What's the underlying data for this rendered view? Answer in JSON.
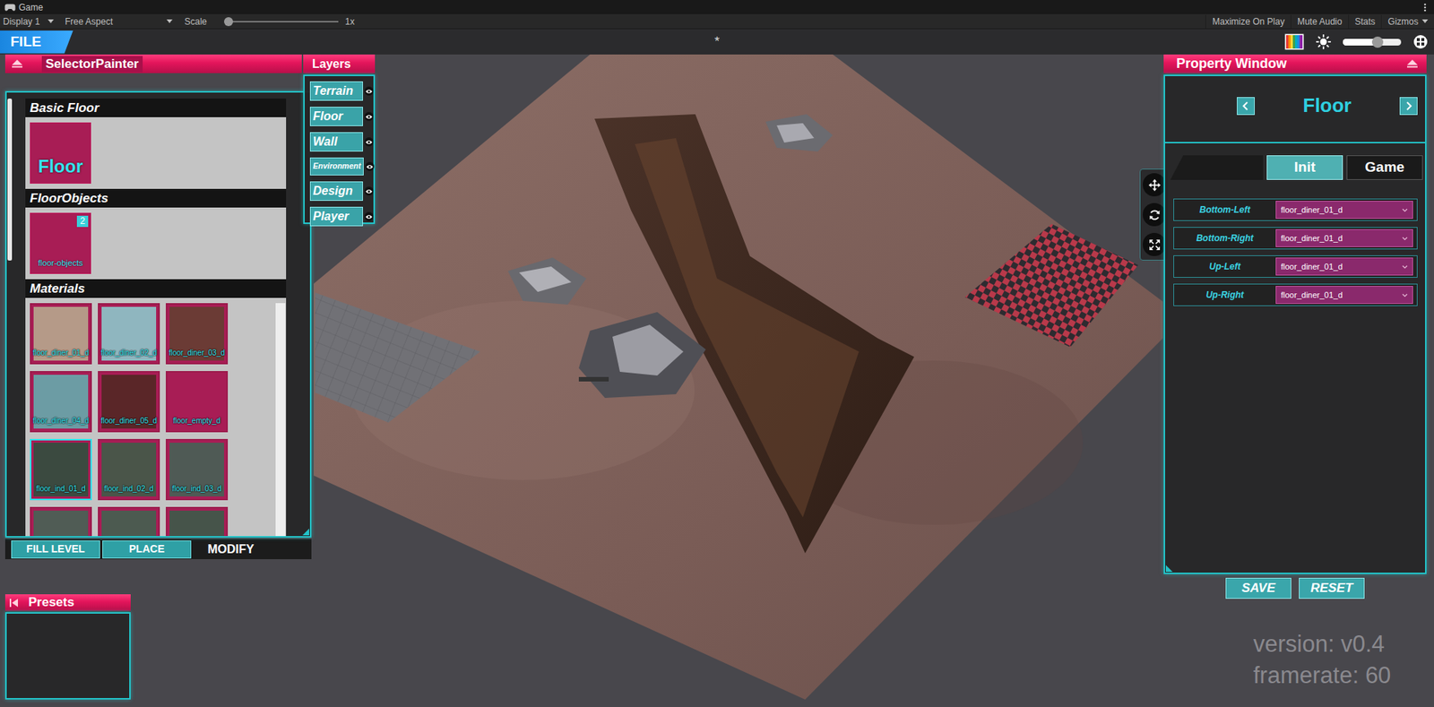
{
  "editor_tab": {
    "title": "Game"
  },
  "unity_toolbar": {
    "display": "Display 1",
    "aspect": "Free Aspect",
    "scale_label": "Scale",
    "scale_level": 0.02,
    "scale_value": "1x",
    "buttons": [
      {
        "label": "Maximize On Play",
        "kind": "toggle"
      },
      {
        "label": "Mute Audio",
        "kind": "toggle"
      },
      {
        "label": "Stats",
        "kind": "toggle"
      },
      {
        "label": "Gizmos",
        "kind": "dropdown"
      }
    ]
  },
  "menu_bar": {
    "file": "FILE",
    "unsaved_marker": "*",
    "brightness_level": 0.6
  },
  "selector_painter": {
    "title": "SelectorPainter",
    "sections": [
      {
        "title": "Basic Floor",
        "items": [
          {
            "label": "Floor",
            "kind": "category"
          }
        ]
      },
      {
        "title": "FloorObjects",
        "items": [
          {
            "label": "floor-objects",
            "kind": "group",
            "badge": "2"
          }
        ]
      }
    ],
    "materials": {
      "title": "Materials",
      "items": [
        {
          "label": "floor_diner_01_d",
          "color": "#b59a88",
          "selected": false
        },
        {
          "label": "floor_diner_02_d",
          "color": "#8fb6bf",
          "selected": false
        },
        {
          "label": "floor_diner_03_d",
          "color": "#6b3b35",
          "selected": false
        },
        {
          "label": "floor_diner_04_d",
          "color": "#6c9ca4",
          "selected": false
        },
        {
          "label": "floor_diner_05_d",
          "color": "#5a2628",
          "selected": false
        },
        {
          "label": "floor_empty_d",
          "color": "#a81d55",
          "selected": false
        },
        {
          "label": "floor_ind_01_d",
          "color": "#3b4a40",
          "selected": true
        },
        {
          "label": "floor_ind_02_d",
          "color": "#4a5549",
          "selected": false
        },
        {
          "label": "floor_ind_03_d",
          "color": "#4f5a55",
          "selected": false
        },
        {
          "color": "#505c55",
          "selected": false
        },
        {
          "color": "#4c5a50",
          "selected": false
        },
        {
          "color": "#46544a",
          "selected": false
        }
      ]
    },
    "modes": [
      {
        "label": "FILL LEVEL",
        "selected": false
      },
      {
        "label": "PLACE",
        "selected": false
      },
      {
        "label": "MODIFY",
        "selected": true
      }
    ]
  },
  "layers": {
    "title": "Layers",
    "items": [
      {
        "label": "Terrain",
        "visible": true
      },
      {
        "label": "Floor",
        "visible": true
      },
      {
        "label": "Wall",
        "visible": true
      },
      {
        "label": "Environment",
        "visible": true
      },
      {
        "label": "Design",
        "visible": true
      },
      {
        "label": "Player",
        "visible": true
      }
    ]
  },
  "presets": {
    "title": "Presets"
  },
  "tools": [
    {
      "kind": "move"
    },
    {
      "kind": "rotate"
    },
    {
      "kind": "scale"
    }
  ],
  "property_window": {
    "title": "Property Window",
    "heading": "Floor",
    "tabs": [
      {
        "label": "Init",
        "selected": true
      },
      {
        "label": "Game",
        "selected": false
      }
    ],
    "fields": [
      {
        "label": "Bottom-Left",
        "value": "floor_diner_01_d"
      },
      {
        "label": "Bottom-Right",
        "value": "floor_diner_01_d"
      },
      {
        "label": "Up-Left",
        "value": "floor_diner_01_d"
      },
      {
        "label": "Up-Right",
        "value": "floor_diner_01_d"
      }
    ],
    "buttons": [
      "SAVE",
      "RESET"
    ]
  },
  "stats": {
    "version": "version: v0.4",
    "framerate": "framerate: 60"
  }
}
